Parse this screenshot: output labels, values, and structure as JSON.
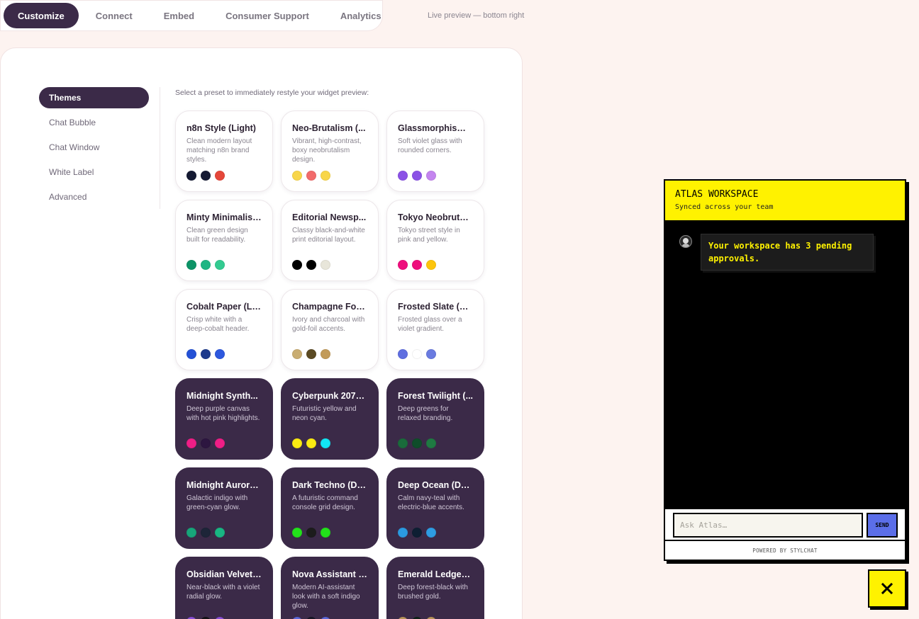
{
  "nav": {
    "tabs": [
      {
        "label": "Customize",
        "active": true
      },
      {
        "label": "Connect"
      },
      {
        "label": "Embed"
      },
      {
        "label": "Consumer Support"
      },
      {
        "label": "Analytics"
      }
    ],
    "preview_note": "Live preview — bottom right"
  },
  "sidebar": {
    "items": [
      {
        "label": "Themes",
        "active": true
      },
      {
        "label": "Chat Bubble"
      },
      {
        "label": "Chat Window"
      },
      {
        "label": "White Label"
      },
      {
        "label": "Advanced"
      }
    ]
  },
  "themes": {
    "hint": "Select a preset to immediately restyle your widget preview:",
    "cards": [
      {
        "name": "n8n Style (Light)",
        "desc": "Clean modern layout matching n8n brand styles.",
        "style": "light",
        "colors": [
          "#151a33",
          "#151a33",
          "#e5473a"
        ]
      },
      {
        "name": "Neo-Brutalism (...",
        "desc": "Vibrant, high-contrast, boxy neobrutalism design.",
        "style": "light",
        "colors": [
          "#f8d64a",
          "#f26b6b",
          "#f8d64a"
        ]
      },
      {
        "name": "Glassmorphism ...",
        "desc": "Soft violet glass with rounded corners.",
        "style": "light",
        "colors": [
          "#8b52e6",
          "#8b52e6",
          "#c485ef"
        ]
      },
      {
        "name": "Minty Minimalist...",
        "desc": "Clean green design built for readability.",
        "style": "light",
        "colors": [
          "#0d9467",
          "#1fb583",
          "#33cb91"
        ]
      },
      {
        "name": "Editorial Newsp...",
        "desc": "Classy black-and-white print editorial layout.",
        "style": "light",
        "colors": [
          "#000000",
          "#000000",
          "#e8e6da"
        ]
      },
      {
        "name": "Tokyo Neobrutal...",
        "desc": "Tokyo street style in pink and yellow.",
        "style": "light",
        "colors": [
          "#ee0f7d",
          "#ee0f7d",
          "#fdc50c"
        ]
      },
      {
        "name": "Cobalt Paper (Li...",
        "desc": "Crisp white with a deep-cobalt header.",
        "style": "light",
        "colors": [
          "#2451d6",
          "#1d3a8c",
          "#2d58de"
        ]
      },
      {
        "name": "Champagne Foil...",
        "desc": "Ivory and charcoal with gold-foil accents.",
        "style": "light",
        "colors": [
          "#c9ad72",
          "#5b4a23",
          "#c29b59"
        ]
      },
      {
        "name": "Frosted Slate (Li...",
        "desc": "Frosted glass over a violet gradient.",
        "style": "light",
        "colors": [
          "#5f6ee0",
          "#ffffff",
          "#6a7be0"
        ]
      },
      {
        "name": "Midnight Synth...",
        "desc": "Deep purple canvas with hot pink highlights.",
        "style": "dark",
        "colors": [
          "#ef1e86",
          "#2d1640",
          "#ef1e86"
        ]
      },
      {
        "name": "Cyberpunk 2077 ...",
        "desc": "Futuristic yellow and neon cyan.",
        "style": "dark",
        "colors": [
          "#fbeb12",
          "#fbeb12",
          "#12e7f5"
        ]
      },
      {
        "name": "Forest Twilight (...",
        "desc": "Deep greens for relaxed branding.",
        "style": "dark",
        "colors": [
          "#1a6b3b",
          "#0f4d2a",
          "#1f7a42"
        ]
      },
      {
        "name": "Midnight Aurora...",
        "desc": "Galactic indigo with green-cyan glow.",
        "style": "dark",
        "colors": [
          "#17a57a",
          "#1d2538",
          "#19b683"
        ]
      },
      {
        "name": "Dark Techno (Da...",
        "desc": "A futuristic command console grid design.",
        "style": "dark",
        "colors": [
          "#22e21a",
          "#1c1c1c",
          "#22e21a"
        ]
      },
      {
        "name": "Deep Ocean (Da...",
        "desc": "Calm navy-teal with electric-blue accents.",
        "style": "dark",
        "colors": [
          "#2b9ae0",
          "#0e1f33",
          "#2e9de3"
        ]
      },
      {
        "name": "Obsidian Velvet ...",
        "desc": "Near-black with a violet radial glow.",
        "style": "dark",
        "colors": [
          "#8a4fd9",
          "#151216",
          "#8a4fd9"
        ]
      },
      {
        "name": "Nova Assistant (...",
        "desc": "Modern AI-assistant look with a soft indigo glow.",
        "style": "dark",
        "colors": [
          "#5b67d8",
          "#171726",
          "#5b67d8"
        ]
      },
      {
        "name": "Emerald Ledger ...",
        "desc": "Deep forest-black with brushed gold.",
        "style": "dark",
        "colors": [
          "#b9955a",
          "#0f2118",
          "#b9955a"
        ]
      }
    ]
  },
  "chat": {
    "title": "ATLAS WORKSPACE",
    "subtitle": "Synced across your team",
    "messages": [
      {
        "from": "bot",
        "text": "Your workspace has 3 pending approvals."
      }
    ],
    "input_placeholder": "Ask Atlas…",
    "send_label": "SEND",
    "powered_by": "POWERED BY STYLCHAT",
    "colors": {
      "accent": "#fff200",
      "background": "#000000",
      "send": "#5b6ee8"
    }
  }
}
